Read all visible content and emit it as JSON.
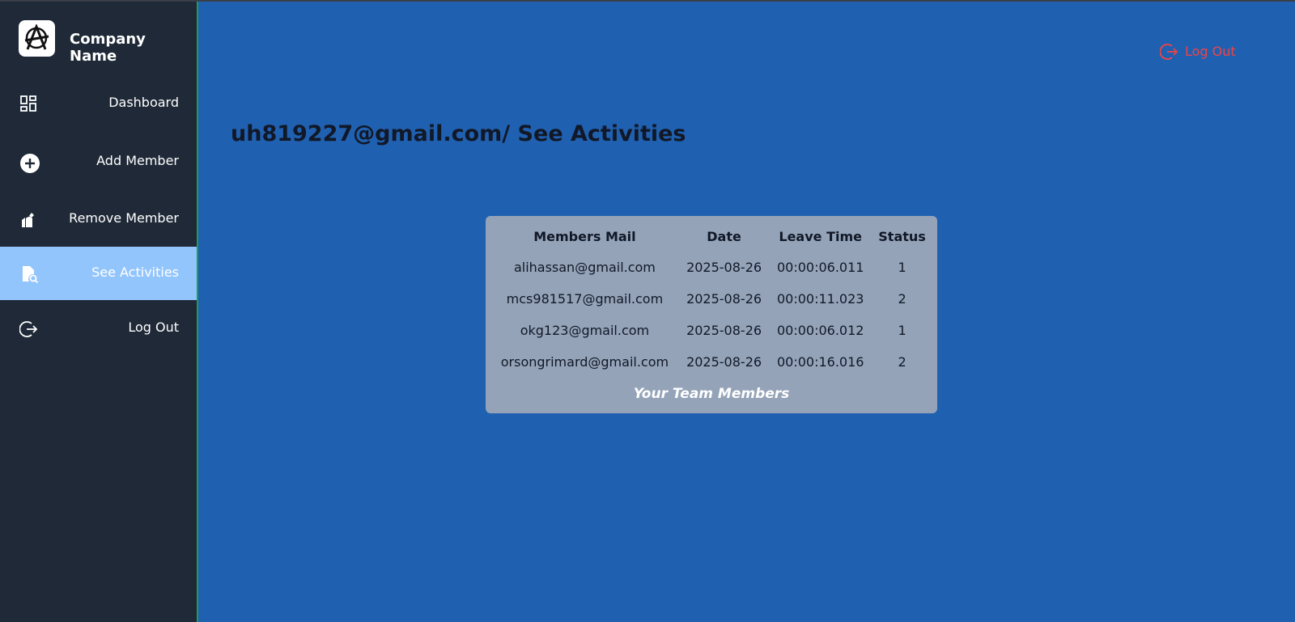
{
  "brand": {
    "name": "Company Name",
    "logo_icon": "anarchy-logo-icon"
  },
  "sidebar": {
    "items": [
      {
        "label": "Dashboard",
        "icon": "dashboard-grid-icon",
        "active": false
      },
      {
        "label": "Add Member",
        "icon": "plus-circle-icon",
        "active": false
      },
      {
        "label": "Remove Member",
        "icon": "remove-member-icon",
        "active": false
      },
      {
        "label": "See Activities",
        "icon": "file-search-icon",
        "active": true
      },
      {
        "label": "Log Out",
        "icon": "logout-icon",
        "active": false
      }
    ]
  },
  "header": {
    "logout_label": "Log Out",
    "logout_color": "#ef4444"
  },
  "main": {
    "title": "uh819227@gmail.com/ See Activities",
    "table": {
      "columns": [
        "Members Mail",
        "Date",
        "Leave Time",
        "Status"
      ],
      "rows": [
        [
          "alihassan@gmail.com",
          "2025-08-26",
          "00:00:06.011",
          "1"
        ],
        [
          "mcs981517@gmail.com",
          "2025-08-26",
          "00:00:11.023",
          "2"
        ],
        [
          "okg123@gmail.com",
          "2025-08-26",
          "00:00:06.012",
          "1"
        ],
        [
          "orsongrimard@gmail.com",
          "2025-08-26",
          "00:00:16.016",
          "2"
        ]
      ],
      "caption": "Your Team Members"
    }
  },
  "colors": {
    "background": "#2060b0",
    "sidebar": "#1f2937",
    "active_item": "#93c5fd",
    "table_card": "#94a3b8"
  }
}
